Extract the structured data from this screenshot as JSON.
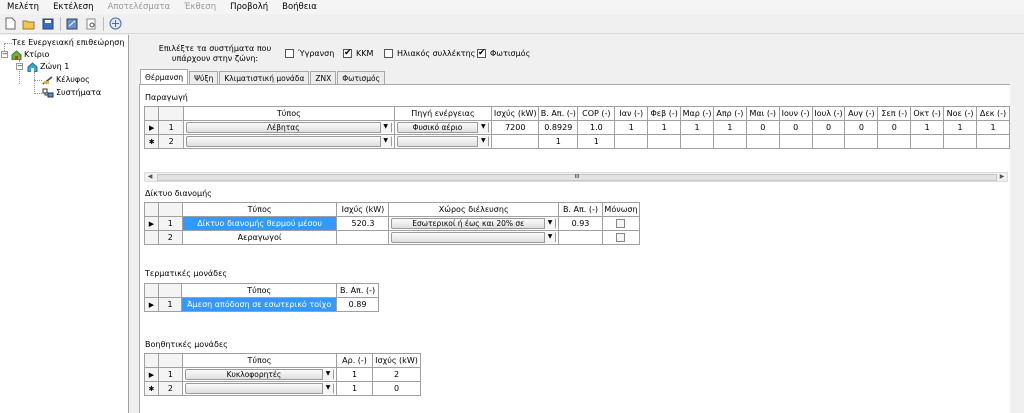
{
  "menu": [
    "Μελέτη",
    "Εκτέλεση",
    "Αποτελέσματα",
    "Έκθεση",
    "Προβολή",
    "Βοήθεια"
  ],
  "tree": {
    "root": "Τεε Ενεργειακή επιθεώρηση",
    "building": "Κτίριο",
    "zone": "Ζώνη 1",
    "shell": "Κέλυφος",
    "systems": "Συστήματα"
  },
  "systems_prompt": "Επιλέξτε τα συστήματα που υπάρχουν στην ζώνη:",
  "systems": [
    {
      "label": "Ύγρανση",
      "checked": false
    },
    {
      "label": "ΚΚΜ",
      "checked": true
    },
    {
      "label": "Ηλιακός συλλέκτης",
      "checked": false
    },
    {
      "label": "Φωτισμός",
      "checked": true
    }
  ],
  "tabs": [
    "Θέρμανση",
    "Ψύξη",
    "Κλιματιστική μονάδα",
    "ΖΝΧ",
    "Φωτισμός"
  ],
  "production": {
    "title": "Παραγωγή",
    "headers": [
      "Τύπος",
      "Πηγή ενέργειας",
      "Ισχύς (kW)",
      "Β. Απ. (-)",
      "COP (-)",
      "Ιαν (-)",
      "Φεβ (-)",
      "Μαρ (-)",
      "Απρ (-)",
      "Μαι (-)",
      "Ιουν (-)",
      "Ιουλ (-)",
      "Αυγ (-)",
      "Σεπ (-)",
      "Οκτ (-)",
      "Νοε (-)",
      "Δεκ (-)"
    ],
    "rows": [
      {
        "mark": "▶",
        "n": "1",
        "type": "Λέβητας",
        "source": "Φυσικό αέριο",
        "power": "7200",
        "eff": "0.8929",
        "cop": "1.0",
        "months": [
          "1",
          "1",
          "1",
          "1",
          "0",
          "0",
          "0",
          "0",
          "0",
          "1",
          "1",
          "1"
        ]
      },
      {
        "mark": "✱",
        "n": "2",
        "type": "",
        "source": "",
        "power": "",
        "eff": "1",
        "cop": "1",
        "months": [
          "",
          "",
          "",
          "",
          "",
          "",
          "",
          "",
          "",
          "",
          "",
          ""
        ]
      }
    ]
  },
  "scroll_grip": "III",
  "distribution": {
    "title": "Δίκτυο διανομής",
    "headers": [
      "Τύπος",
      "Ισχύς (kW)",
      "Χώρος διέλευσης",
      "Β. Απ. (-)",
      "Μόνωση"
    ],
    "rows": [
      {
        "mark": "▶",
        "n": "1",
        "type": "Δίκτυο διανομής θερμού μέσου",
        "power": "520.3",
        "space": "Εσωτερικοί ή έως και 20% σε",
        "eff": "0.93"
      },
      {
        "mark": "",
        "n": "2",
        "type": "Αεραγωγοί",
        "power": "",
        "space": "",
        "eff": ""
      }
    ]
  },
  "terminal": {
    "title": "Τερματικές μονάδες",
    "headers": [
      "Τύπος",
      "Β. Απ. (-)"
    ],
    "rows": [
      {
        "mark": "▶",
        "n": "1",
        "type": "Άμεση απόδοση σε εσωτερικό τοίχο",
        "eff": "0.89"
      }
    ]
  },
  "aux": {
    "title": "Βοηθητικές μονάδες",
    "headers": [
      "Τύπος",
      "Αρ. (-)",
      "Ισχύς (kW)"
    ],
    "rows": [
      {
        "mark": "▶",
        "n": "1",
        "type": "Κυκλοφορητές",
        "count": "1",
        "power": "2"
      },
      {
        "mark": "✱",
        "n": "2",
        "type": "",
        "count": "1",
        "power": "0"
      }
    ]
  }
}
